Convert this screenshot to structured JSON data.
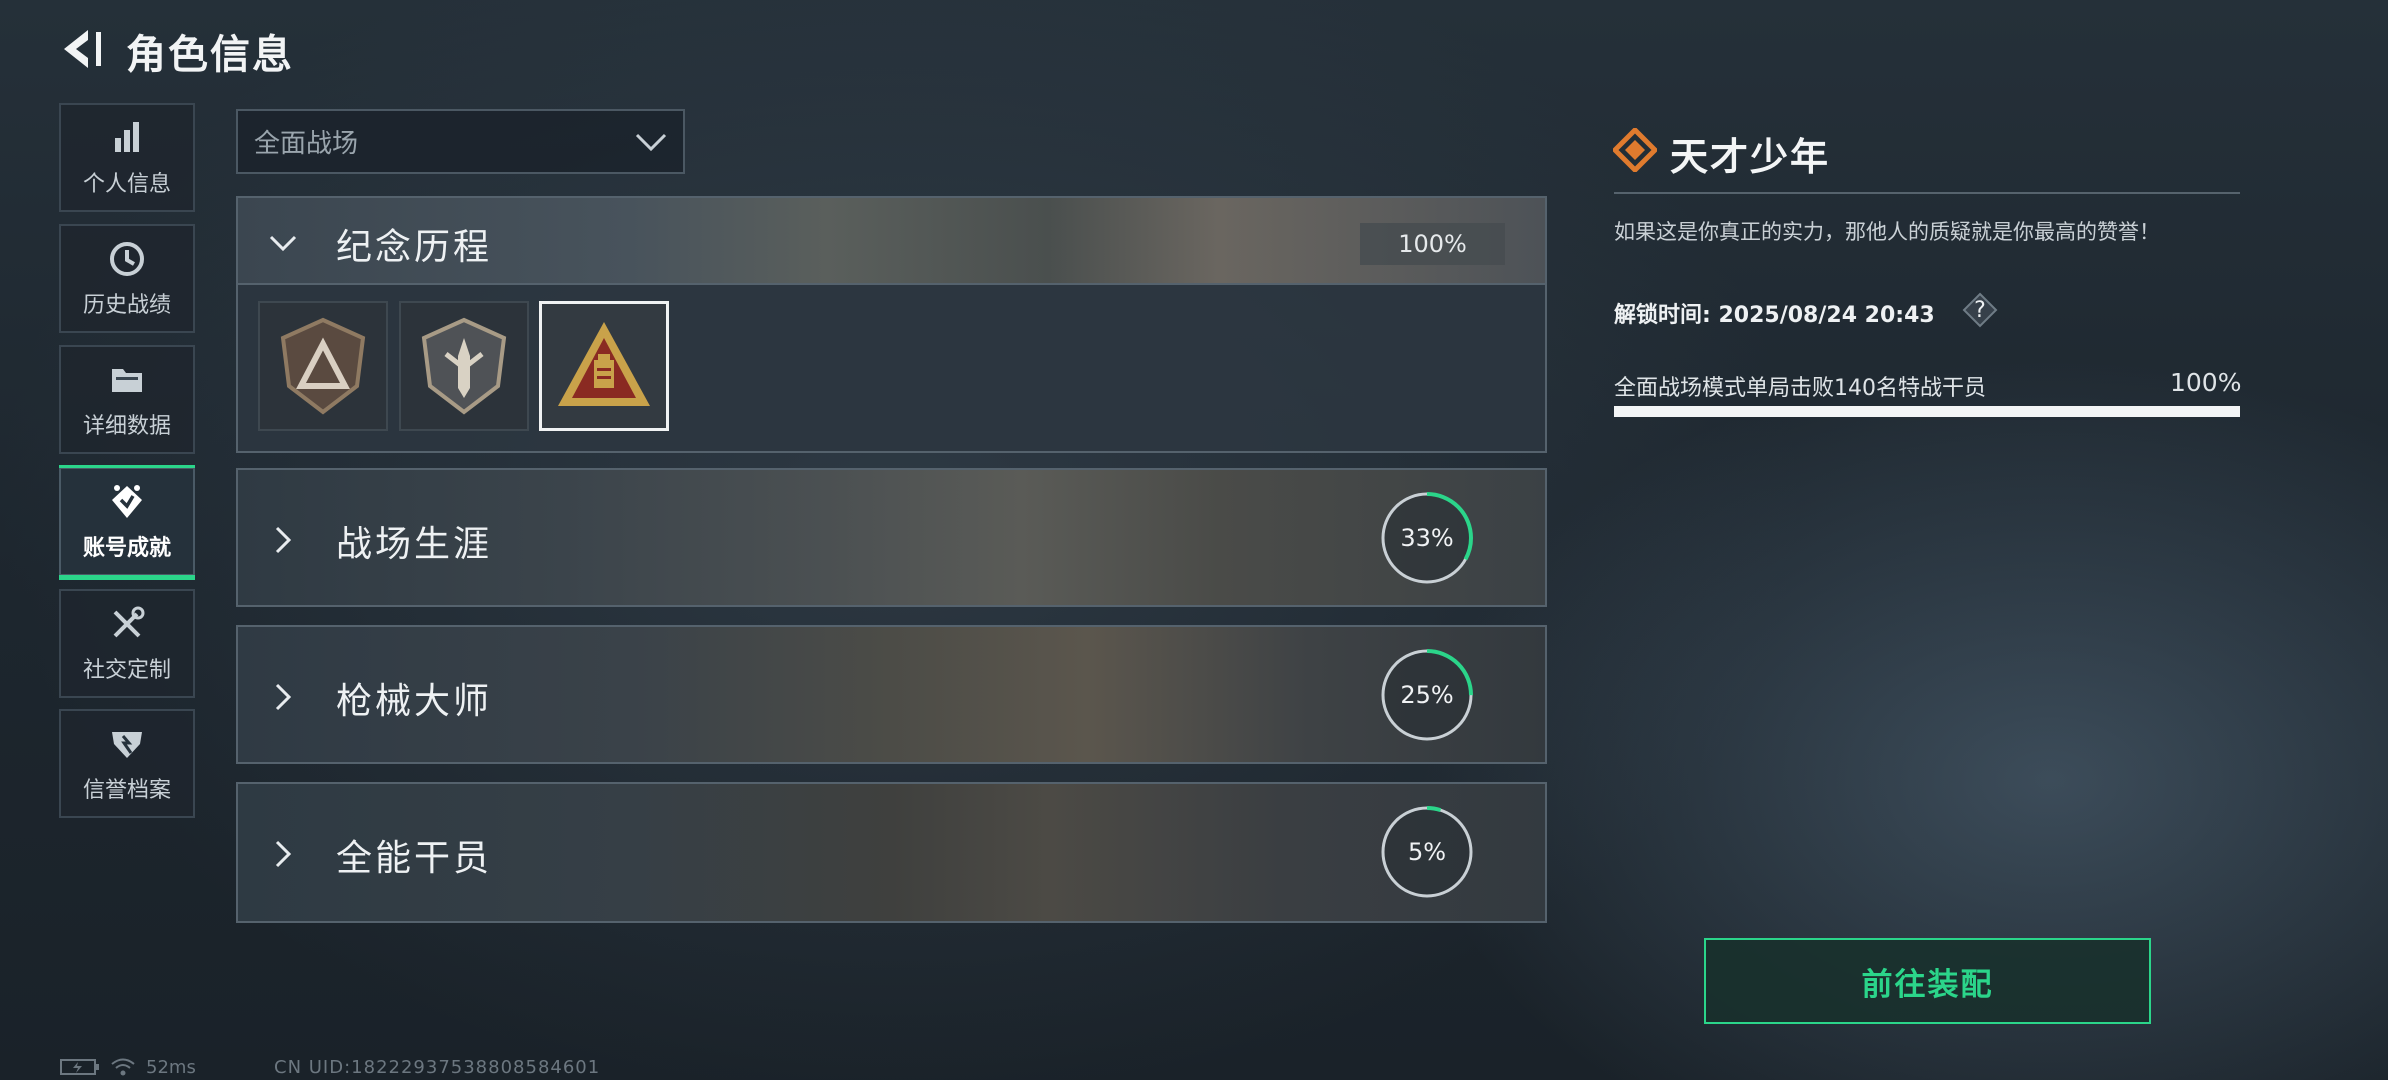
{
  "header": {
    "title": "角色信息",
    "back_icon": "back-arrow-icon"
  },
  "sidebar": {
    "items": [
      {
        "label": "个人信息",
        "icon": "bar-chart-icon",
        "active": false
      },
      {
        "label": "历史战绩",
        "icon": "clock-icon",
        "active": false
      },
      {
        "label": "详细数据",
        "icon": "folder-icon",
        "active": false
      },
      {
        "label": "账号成就",
        "icon": "achievement-icon",
        "active": true
      },
      {
        "label": "社交定制",
        "icon": "tools-icon",
        "active": false
      },
      {
        "label": "信誉档案",
        "icon": "shield-badge-icon",
        "active": false
      }
    ]
  },
  "mode_select": {
    "value": "全面战场"
  },
  "categories": [
    {
      "name": "纪念历程",
      "progress_label": "100%",
      "progress": 1.0,
      "expanded": true
    },
    {
      "name": "战场生涯",
      "progress_label": "33%",
      "progress": 0.33,
      "expanded": false
    },
    {
      "name": "枪械大师",
      "progress_label": "25%",
      "progress": 0.25,
      "expanded": false
    },
    {
      "name": "全能干员",
      "progress_label": "5%",
      "progress": 0.05,
      "expanded": false
    }
  ],
  "badges": [
    {
      "icon": "triangle-emblem-icon",
      "selected": false
    },
    {
      "icon": "dagger-emblem-icon",
      "selected": false
    },
    {
      "icon": "gold-triangle-emblem-icon",
      "selected": true
    }
  ],
  "detail": {
    "title": "天才少年",
    "description": "如果这是你真正的实力，那他人的质疑就是你最高的赞誉！",
    "unlock_label": "解锁时间:",
    "unlock_time": "2025/08/24 20:43",
    "help": "?",
    "task": "全面战场模式单局击败140名特战干员",
    "task_progress_label": "100%",
    "task_progress": 1.0
  },
  "equip_button": {
    "label": "前往装配"
  },
  "status": {
    "ping": "52ms",
    "uid": "CN UID:18222937538808584601"
  },
  "colors": {
    "accent": "#2bd58a",
    "detail_icon": "#e07b2e",
    "badge_gold": "#c9a24a",
    "badge_red": "#8a2a22"
  }
}
